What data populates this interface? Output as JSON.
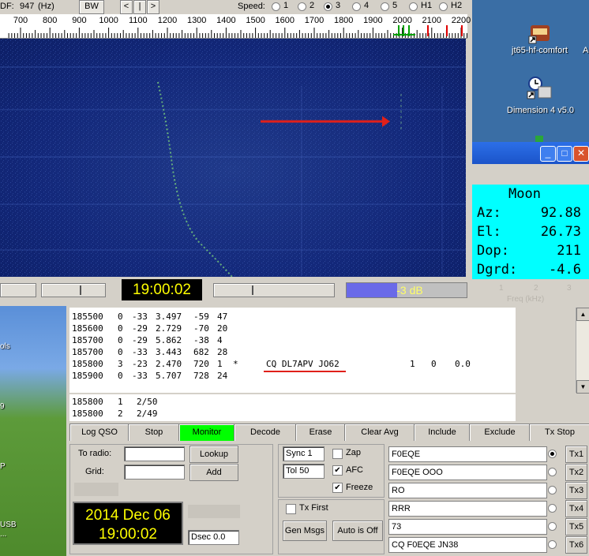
{
  "toolbar": {
    "df_label": "DF:",
    "df_value": "947",
    "df_unit": "(Hz)",
    "bw_button": "BW",
    "nav_left": "<",
    "nav_center": "|",
    "nav_right": ">",
    "speed_label": "Speed:",
    "speed_options": [
      "1",
      "2",
      "3",
      "4",
      "5",
      "H1",
      "H2"
    ],
    "speed_selected": "3"
  },
  "scale": {
    "ticks": [
      "700",
      "800",
      "900",
      "1000",
      "1100",
      "1200",
      "1300",
      "1400",
      "1500",
      "1600",
      "1700",
      "1800",
      "1900",
      "2000",
      "2100",
      "2200"
    ]
  },
  "waterfall_status": {
    "clock": "19:00:02",
    "level": "-3 dB"
  },
  "desktop": {
    "icon1_label": "jt65-hf-comfort",
    "icon1_partial": "A",
    "icon2_label": "Dimension 4 v5.0",
    "left_labels": [
      "ols",
      "9",
      "P",
      "USB",
      "..."
    ]
  },
  "moon": {
    "title": "Moon",
    "az_label": "Az:",
    "az_value": "92.88",
    "el_label": "El:",
    "el_value": "26.73",
    "dop_label": "Dop:",
    "dop_value": "211",
    "dgrd_label": "Dgrd:",
    "dgrd_value": "-4.6",
    "ghost_numbers": [
      "1",
      "2",
      "3"
    ],
    "ghost_label": "Freq (kHz)"
  },
  "decodes": [
    {
      "t": "185500",
      "sync": "0",
      "db": "-33",
      "dt": "3.497",
      "df": "-59",
      "w": "47",
      "flag": "",
      "msg": "",
      "n1": "",
      "n2": "",
      "n3": ""
    },
    {
      "t": "185600",
      "sync": "0",
      "db": "-29",
      "dt": "2.729",
      "df": "-70",
      "w": "20",
      "flag": "",
      "msg": "",
      "n1": "",
      "n2": "",
      "n3": ""
    },
    {
      "t": "185700",
      "sync": "0",
      "db": "-29",
      "dt": "5.862",
      "df": "-38",
      "w": "4",
      "flag": "",
      "msg": "",
      "n1": "",
      "n2": "",
      "n3": ""
    },
    {
      "t": "185700",
      "sync": "0",
      "db": "-33",
      "dt": "3.443",
      "df": "682",
      "w": "28",
      "flag": "",
      "msg": "",
      "n1": "",
      "n2": "",
      "n3": ""
    },
    {
      "t": "185800",
      "sync": "3",
      "db": "-23",
      "dt": "2.470",
      "df": "720",
      "w": "1",
      "flag": "*",
      "msg": "CQ DL7APV JO62",
      "n1": "1",
      "n2": "0",
      "n3": "0.0"
    },
    {
      "t": "185900",
      "sync": "0",
      "db": "-33",
      "dt": "5.707",
      "df": "728",
      "w": "24",
      "flag": "",
      "msg": "",
      "n1": "",
      "n2": "",
      "n3": ""
    }
  ],
  "averages": [
    {
      "t": "185800",
      "n": "1",
      "frac": "2/50"
    },
    {
      "t": "185800",
      "n": "2",
      "frac": "2/49"
    }
  ],
  "buttons": {
    "log_qso": "Log QSO",
    "stop": "Stop",
    "monitor": "Monitor",
    "decode": "Decode",
    "erase": "Erase",
    "clear_avg": "Clear Avg",
    "include": "Include",
    "exclude": "Exclude",
    "tx_stop": "Tx Stop"
  },
  "station": {
    "to_radio_label": "To radio:",
    "to_radio_value": "",
    "grid_label": "Grid:",
    "grid_value": "",
    "lookup": "Lookup",
    "add": "Add",
    "date": "2014 Dec 06",
    "time": "19:00:02",
    "dsec": "Dsec  0.0"
  },
  "controls": {
    "sync": "Sync  1",
    "tol": "Tol   50",
    "zap": "Zap",
    "zap_checked": false,
    "afc": "AFC",
    "afc_checked": true,
    "freeze": "Freeze",
    "freeze_checked": true,
    "tx_first": "Tx First",
    "tx_first_checked": false,
    "gen_msgs": "Gen Msgs",
    "auto_off": "Auto is Off"
  },
  "tx_messages": [
    {
      "text": "F0EQE",
      "button": "Tx1",
      "selected": true
    },
    {
      "text": "F0EQE OOO",
      "button": "Tx2",
      "selected": false
    },
    {
      "text": "RO",
      "button": "Tx3",
      "selected": false
    },
    {
      "text": "RRR",
      "button": "Tx4",
      "selected": false
    },
    {
      "text": "73",
      "button": "Tx5",
      "selected": false
    },
    {
      "text": "CQ F0EQE JN38",
      "button": "Tx6",
      "selected": false
    }
  ],
  "colors": {
    "waterfall": "#13287a",
    "monitor_active": "#00ff00",
    "clock_text": "#ffff00",
    "moon_bg": "#00ffff",
    "annotation": "#e0201a"
  }
}
